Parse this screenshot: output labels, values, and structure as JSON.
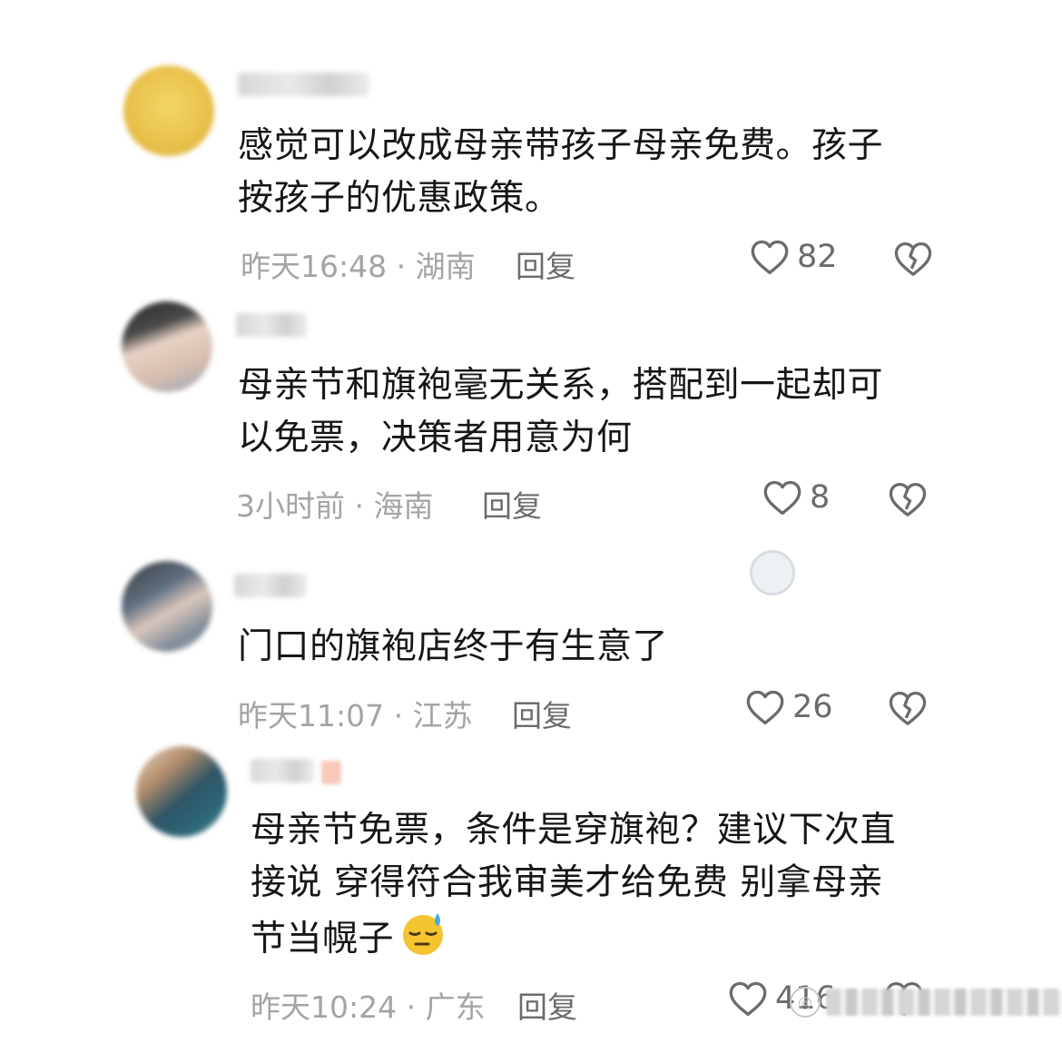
{
  "comments": [
    {
      "text": "感觉可以改成母亲带孩子母亲免费。孩子\n按孩子的优惠政策。",
      "time_location": "昨天16:48 · 湖南",
      "reply_label": "回复",
      "likes": "82"
    },
    {
      "text": "母亲节和旗袍毫无关系，搭配到一起却可\n以免票，决策者用意为何",
      "time_location": "3小时前 · 海南",
      "reply_label": "回复",
      "likes": "8"
    },
    {
      "text": "门口的旗袍店终于有生意了",
      "time_location": "昨天11:07 · 江苏",
      "reply_label": "回复",
      "likes": "26"
    },
    {
      "text": "母亲节免票，条件是穿旗袍？建议下次直\n接说 穿得符合我审美才给免费 别拿母亲\n节当幌子",
      "time_location": "昨天10:24 · 广东",
      "reply_label": "回复",
      "likes": "416"
    }
  ],
  "icons": {
    "like": "heart-outline-icon",
    "dislike": "broken-heart-icon",
    "emoji": "sleepy-sweat-emoji"
  },
  "colors": {
    "text": "#161616",
    "meta": "#a4a4a4",
    "action": "#6b6b6b"
  }
}
